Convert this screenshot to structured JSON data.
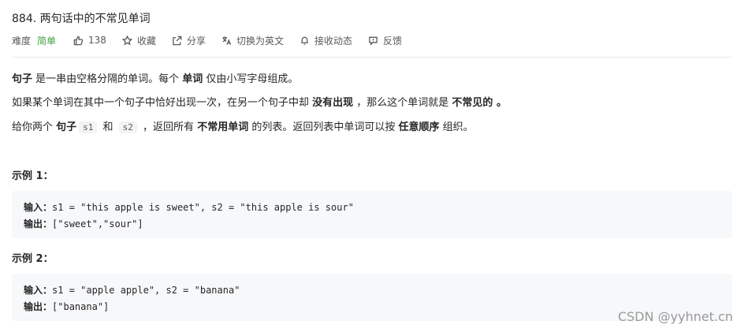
{
  "problem": {
    "title": "884. 两句话中的不常见单词"
  },
  "meta": {
    "difficulty_label": "难度",
    "difficulty_value": "简单",
    "likes": "138",
    "favorite": "收藏",
    "share": "分享",
    "switch_lang": "切换为英文",
    "follow": "接收动态",
    "feedback": "反馈",
    "difficulty_color": "#43a047"
  },
  "description": {
    "p1": {
      "t1": "句子",
      "t2": " 是一串由空格分隔的单词。每个 ",
      "t3": "单词",
      "t4": " 仅由小写字母组成。"
    },
    "p2": {
      "t1": "如果某个单词在其中一个句子中恰好出现一次，在另一个句子中却 ",
      "t2": "没有出现",
      "t3": " ，那么这个单词就是 ",
      "t4": "不常见的",
      "t5": " 。"
    },
    "p3": {
      "t1": "给你两个 ",
      "t2": "句子",
      "code1": "s1",
      "t3": " 和 ",
      "code2": "s2",
      "t4": " ，返回所有 ",
      "t5": "不常用单词",
      "t6": " 的列表。返回列表中单词可以按 ",
      "t7": "任意顺序",
      "t8": " 组织。"
    }
  },
  "examples": [
    {
      "title": "示例 1：",
      "input_label": "输入：",
      "input": "s1 = \"this apple is sweet\", s2 = \"this apple is sour\"",
      "output_label": "输出：",
      "output": "[\"sweet\",\"sour\"]"
    },
    {
      "title": "示例 2：",
      "input_label": "输入：",
      "input": "s1 = \"apple apple\", s2 = \"banana\"",
      "output_label": "输出：",
      "output": "[\"banana\"]"
    }
  ],
  "watermark": "CSDN @yyhnet.cn"
}
